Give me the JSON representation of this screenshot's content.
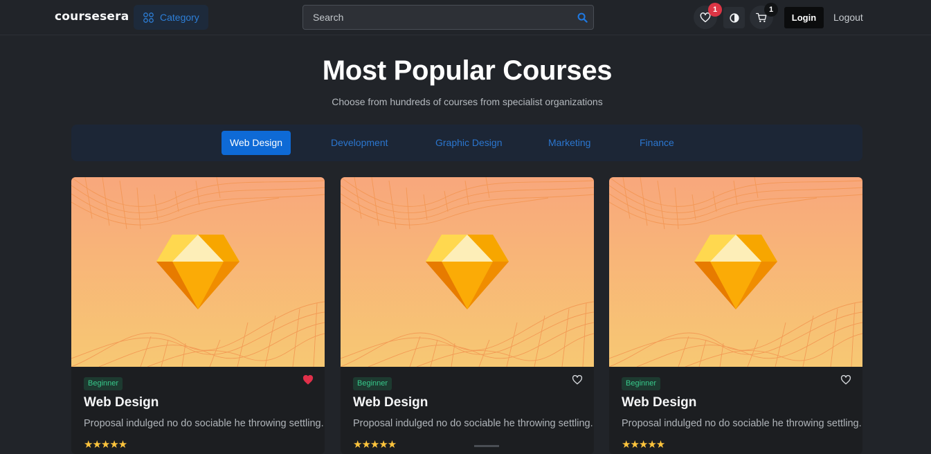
{
  "header": {
    "logo": "coursesera",
    "category_label": "Category",
    "search_placeholder": "Search",
    "wishlist_count": "1",
    "cart_count": "1",
    "login_label": "Login",
    "logout_label": "Logout"
  },
  "hero": {
    "title": "Most Popular Courses",
    "subtitle": "Choose from hundreds of courses from specialist organizations"
  },
  "tabs": [
    {
      "label": "Web Design",
      "active": true
    },
    {
      "label": "Development",
      "active": false
    },
    {
      "label": "Graphic Design",
      "active": false
    },
    {
      "label": "Marketing",
      "active": false
    },
    {
      "label": "Finance",
      "active": false
    }
  ],
  "courses": [
    {
      "level": "Beginner",
      "title": "Web Design",
      "description": "Proposal indulged no do sociable he throwing settling.",
      "rating": 5,
      "wishlisted": true
    },
    {
      "level": "Beginner",
      "title": "Web Design",
      "description": "Proposal indulged no do sociable he throwing settling.",
      "rating": 5,
      "wishlisted": false
    },
    {
      "level": "Beginner",
      "title": "Web Design",
      "description": "Proposal indulged no do sociable he throwing settling.",
      "rating": 5,
      "wishlisted": false
    }
  ],
  "icons": {
    "category": "grid-icon",
    "search": "search-icon",
    "wishlist": "heart-icon",
    "theme": "half-circle-icon",
    "cart": "cart-icon",
    "thumbnail": "diamond-icon",
    "star": "star-icon"
  },
  "colors": {
    "accent": "#0e6ad6",
    "link": "#2b76cf",
    "badge_red": "#dc3545",
    "level_green": "#38c98b",
    "star": "#ffc53d"
  }
}
